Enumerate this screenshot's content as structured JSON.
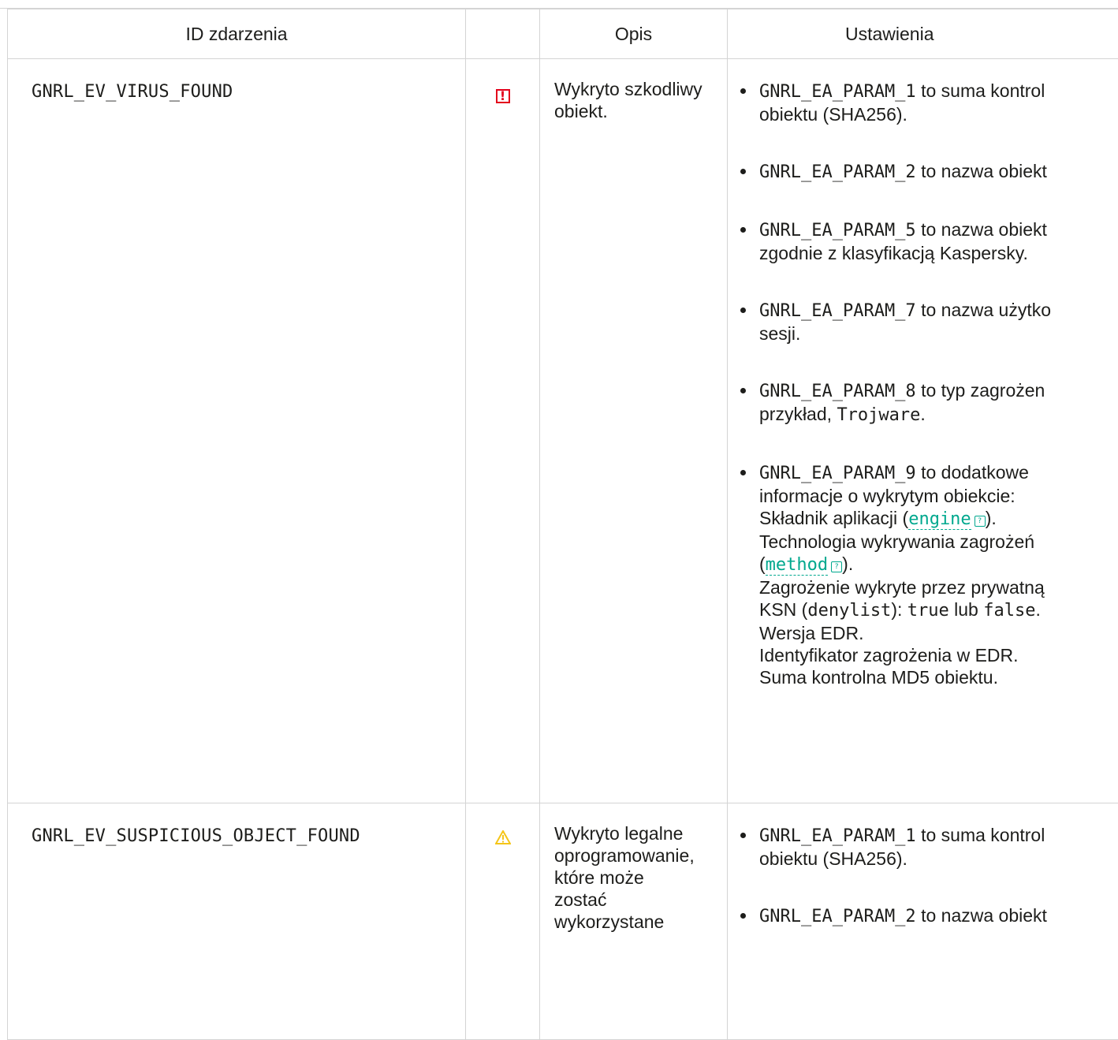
{
  "table": {
    "headers": {
      "id": "ID zdarzenia",
      "icon": "",
      "description": "Opis",
      "settings": "Ustawienia"
    },
    "rows": [
      {
        "id": "GNRL_EV_VIRUS_FOUND",
        "icon": "critical-severity-icon",
        "description": "Wykryto szkodliwy obiekt.",
        "params": [
          {
            "code": "GNRL_EA_PARAM_1",
            "text": " to suma kontrol",
            "rest": "obiektu (SHA256)."
          },
          {
            "code": "GNRL_EA_PARAM_2",
            "text": " to nazwa obiekt",
            "rest": ""
          },
          {
            "code": "GNRL_EA_PARAM_5",
            "text": " to nazwa obiekt",
            "rest": "zgodnie z klasyfikacją Kaspersky."
          },
          {
            "code": "GNRL_EA_PARAM_7",
            "text": " to nazwa użytko",
            "rest": "sesji."
          },
          {
            "code": "GNRL_EA_PARAM_8",
            "text": " to typ zagrożen",
            "rest_prefix": "przykład, ",
            "rest_code": "Trojware",
            "rest_suffix": "."
          },
          {
            "code": "GNRL_EA_PARAM_9",
            "text": " to dodatkowe",
            "details": {
              "line1": "informacje o wykrytym obiekcie:",
              "component_prefix": "Składnik aplikacji (",
              "component_link": "engine",
              "component_suffix": ").",
              "technology": "Technologia wykrywania zagrożeń",
              "method_prefix": "(",
              "method_link": "method",
              "method_suffix": ").",
              "ksn_line": "Zagrożenie wykryte przez prywatną",
              "ksn_prefix": "KSN (",
              "ksn_code": "denylist",
              "ksn_mid": "): ",
              "ksn_true": "true",
              "ksn_or": " lub ",
              "ksn_false": "false",
              "ksn_end": ".",
              "edr_version": "Wersja EDR.",
              "edr_id": "Identyfikator zagrożenia w EDR.",
              "md5": "Suma kontrolna MD5 obiektu."
            }
          }
        ]
      },
      {
        "id": "GNRL_EV_SUSPICIOUS_OBJECT_FOUND",
        "icon": "warning-severity-icon",
        "description_lines": [
          "Wykryto legalne",
          "oprogramowanie,",
          "które może",
          "zostać",
          "wykorzystane"
        ],
        "params": [
          {
            "code": "GNRL_EA_PARAM_1",
            "text": " to suma kontrol",
            "rest": "obiektu (SHA256)."
          },
          {
            "code": "GNRL_EA_PARAM_2",
            "text": " to nazwa obiekt",
            "rest": ""
          }
        ]
      }
    ]
  },
  "colors": {
    "critical": "#e3001b",
    "warning": "#f5c518",
    "link": "#00a88e",
    "border": "#d4d4d4"
  }
}
